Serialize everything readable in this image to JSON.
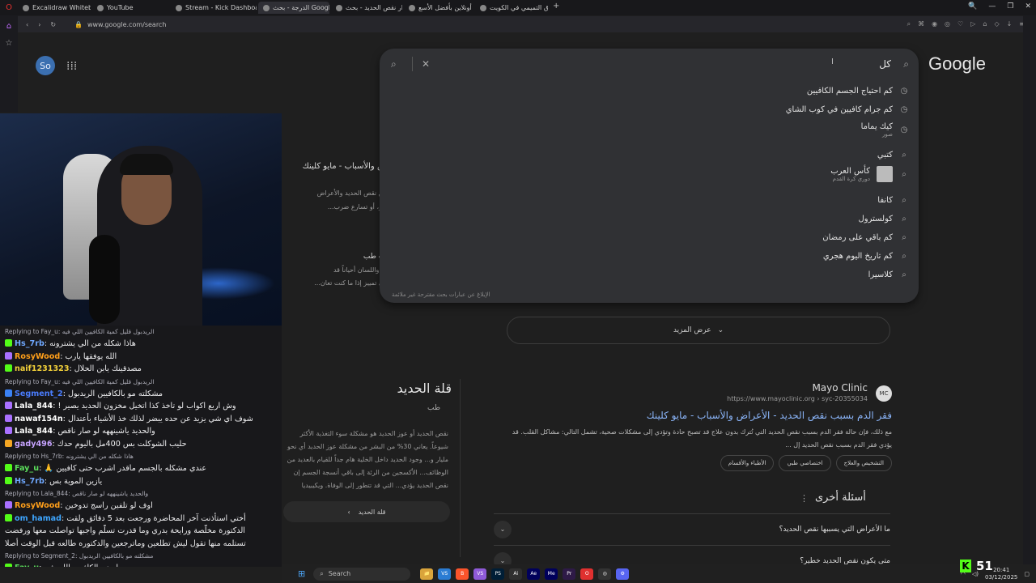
{
  "browser": {
    "tabs": [
      {
        "label": "Excalidraw Whiteboard",
        "active": false
      },
      {
        "label": "YouTube",
        "active": false
      },
      {
        "label": "Stream - Kick Dashboard",
        "active": false
      },
      {
        "label": "الدرجة - بحث Google",
        "active": true
      },
      {
        "label": "أضرار نقص الحديد - بحث Go",
        "active": false
      },
      {
        "label": "اشتري أونلاين بأفضل الأسع",
        "active": false
      },
      {
        "label": "أسواق التميمي في الكويت",
        "active": false
      }
    ],
    "tab_close": "×",
    "new_tab": "+",
    "url": "www.google.com/search",
    "window_controls": [
      "🔍",
      "—",
      "❐",
      "✕"
    ]
  },
  "google": {
    "logo": "Google",
    "avatar": "So",
    "apps_icon": "⋮⋮⋮",
    "search": {
      "query": "كل",
      "search_icon": "⌕",
      "clear_icon": "✕",
      "suggestions": [
        {
          "text": "كم احتياج الجسم الكافيين",
          "icon": "history"
        },
        {
          "text": "كم جرام كافيين في كوب الشاي",
          "icon": "history"
        },
        {
          "text": "كيك يماما",
          "sub": "صور",
          "icon": "history"
        },
        {
          "text": "كتبي",
          "icon": "search"
        },
        {
          "text": "كأس العرب",
          "sub": "دوري كرة القدم",
          "icon": "search",
          "thumb": true
        },
        {
          "text": "كانفا",
          "icon": "search"
        },
        {
          "text": "كولسترول",
          "icon": "search"
        },
        {
          "text": "كم باقي على رمضان",
          "icon": "search"
        },
        {
          "text": "كم تاريخ اليوم هجري",
          "icon": "search"
        },
        {
          "text": "كلاسيرا",
          "icon": "search"
        }
      ],
      "report": "الإبلاغ عن عبارات بحث مقترحة غير ملائمة"
    },
    "bg_snippets": [
      "لأعراض والأسباب - مايو كلينك",
      "الناتج عن نقص الحديد والأعراض",
      "لم الصدر، أو تسارع ضرب...",
      "م - ويب طب",
      "في الفم واللسان أحياناً قد",
      "سك على تمييز إذا ما كنت تعان..."
    ],
    "show_more": "عرض المزيد",
    "result": {
      "site": "Mayo Clinic",
      "url": "https://www.mayoclinic.org › syc-20355034",
      "favicon": "MC",
      "title": "فقر الدم بسبب نقص الحديد - الأعراض والأسباب - مايو كلينك",
      "snippet_line1": "مع ذلك، فإن حالة فقر الدم بسبب نقص الحديد التي تُترك بدون علاج قد تصبح حادة وتؤدي إلى مشكلات صحية، تشمل التالي: مشاكل القلب. قد",
      "snippet_line2": "يؤدي فقر الدم بسبب نقص الحديد إل ...",
      "chips": [
        "التشخيص والعلاج",
        "اختصاصي طبي",
        "الأطباء والأقسام"
      ]
    },
    "knowledge_panel": {
      "title": "قلة الحديد",
      "subtitle": "طب",
      "text": "نقص الحديد أو عوز الحديد هو مشكلة سوء التغذية الأكثر شيوعاً. يعاني 30% من البشر من مشكلة عوز الحديد أي نحو مليار و... وجود الحديد داخل الخلية هام جداً للقيام بالعديد من الوظائف... الأكسجين من الرئة إلى باقي أنسجة الجسم إن نقص الحديد يؤدي... التي قد تتطور إلى الوفاة. ويكيبيديا",
      "link": "قلة الحديد",
      "link_chevron": "‹"
    },
    "paa": {
      "title": "أسئلة أخرى",
      "menu": "⋮",
      "questions": [
        "ما الأعراض التي يسببها نقص الحديد؟",
        "متى يكون نقص الحديد خطير؟"
      ],
      "chevron": "⌄"
    }
  },
  "chat": {
    "messages": [
      {
        "reply": true,
        "text": "Replying to Fay_u: الريدبول قليل كمية الكافيين اللي فيه"
      },
      {
        "badge": "bg",
        "user": "Hs_7rb",
        "color": "#6fa8ff",
        "text": "هاذا شكله من الي يشترونه"
      },
      {
        "badge": "bp",
        "user": "RosyWood",
        "color": "#ff9f1a",
        "text": "الله يوفقها يارب"
      },
      {
        "badge": "bg",
        "user": "naif1231323",
        "color": "#f5d33a",
        "text": "مصدقينك يابن الحلال"
      },
      {
        "reply": true,
        "text": "Replying to Fay_u: الريدبول قليل كمية الكافيين اللي فيه"
      },
      {
        "badge": "bb",
        "user": "Segment_2",
        "color": "#4a7dff",
        "text": "مشكلته مو بالكافيين الريدبول"
      },
      {
        "badge": "bp",
        "user": "Lala_844",
        "color": "#ffffff",
        "text": "وش اربع اكواب لو تاخذ كذا اتخيل مخزون الحديد يصير !"
      },
      {
        "badge": "bp",
        "user": "nawaf154n",
        "color": "#ffffff",
        "text": "شوف اي شي يزيد عن حده يبضر لذلك خذ الأشياء بأعتدال"
      },
      {
        "badge": "bp",
        "user": "Lala_844",
        "color": "#ffffff",
        "text": "والحديد ياشينههه لو صار ناقص"
      },
      {
        "badge": "by",
        "user": "gady496",
        "color": "#c6a3ff",
        "text": "حليب الشوكلت بس 400مل باليوم حدك"
      },
      {
        "reply": true,
        "text": "Replying to Hs_7rb: هاذا شكله من الي يشترونه"
      },
      {
        "badge": "bg",
        "user": "Fay_u",
        "color": "#5ce05c",
        "text": "عندي مشكله بالجسم ماقدر اشرب حتى كافيين 🙏"
      },
      {
        "badge": "bg",
        "user": "Hs_7rb",
        "color": "#6fa8ff",
        "text": "يازين الموية بس"
      },
      {
        "reply": true,
        "text": "Replying to Lala_844: والحديد ياشينههه لو صار ناقص"
      },
      {
        "badge": "bp",
        "user": "RosyWood",
        "color": "#ff9f1a",
        "text": "اوف لو تلفين راسج تدوخين"
      },
      {
        "badge": "bg",
        "user": "om_hamad",
        "color": "#3ea6ff",
        "text": "أختي استأذنت آخر المحاضرة ورجعت بعد 5 دقائق ولقت"
      },
      {
        "plain": true,
        "text": "الدكتورة مخلّصة ورايحة بدري وما قدرت تسلّم واجبها تواصلت معها ورفضت"
      },
      {
        "plain": true,
        "text": "تستلمه منها تقول ليش تطلعين وماترجعين والدكتوره طالعه قبل الوقت أصلا"
      },
      {
        "reply": true,
        "text": "Replying to Segment_2: مشكلته مو بالكافيين الريدبول"
      },
      {
        "badge": "bg",
        "user": "Fay_u",
        "color": "#5ce05c",
        "text": "صح بس اوضح الكافيين اللي فيه"
      }
    ]
  },
  "taskbar": {
    "search_label": "Search",
    "apps": [
      "📁",
      "VS",
      "B",
      "VS",
      "PS",
      "Ai",
      "Ae",
      "Me",
      "Pr",
      "O",
      "◎",
      "⚙"
    ],
    "clock_time": "20:41",
    "clock_date": "03/12/2025",
    "viewers": "51",
    "kick_logo": "K"
  },
  "colors": {
    "accent": "#53fc18",
    "link": "#8ab4f8"
  }
}
